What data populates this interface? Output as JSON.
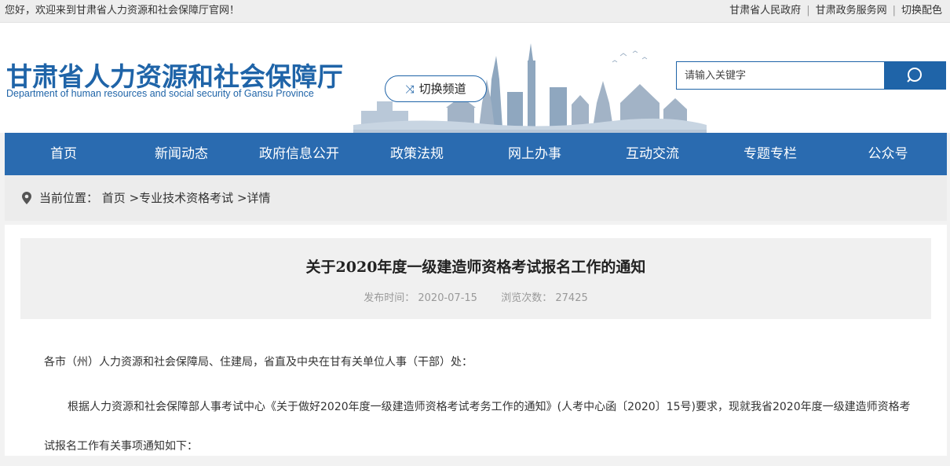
{
  "topbar": {
    "welcome": "您好，欢迎来到甘肃省人力资源和社会保障厅官网！",
    "links": [
      "甘肃省人民政府",
      "甘肃政务服务网",
      "切换配色"
    ]
  },
  "header": {
    "title_cn": "甘肃省人力资源和社会保障厅",
    "title_en": "Department of human resources and social security of Gansu Province",
    "switch_label": "切换频道",
    "search_placeholder": "请输入关键字"
  },
  "nav": [
    "首页",
    "新闻动态",
    "政府信息公开",
    "政策法规",
    "网上办事",
    "互动交流",
    "专题专栏",
    "公众号"
  ],
  "breadcrumb": {
    "label": "当前位置：",
    "items": [
      "首页",
      "专业技术资格考试",
      "详情"
    ]
  },
  "article": {
    "title": "关于2020年度一级建造师资格考试报名工作的通知",
    "publish_label": "发布时间：",
    "publish_date": "2020-07-15",
    "views_label": "浏览次数：",
    "views": "27425",
    "para1": "各市（州）人力资源和社会保障局、住建局，省直及中央在甘有关单位人事（干部）处：",
    "para2": "根据人力资源和社会保障部人事考试中心《关于做好2020年度一级建造师资格考试考务工作的通知》(人考中心函〔2020〕15号)要求，现就我省2020年度一级建造师资格考试报名工作有关事项通知如下："
  },
  "colors": {
    "brand": "#1f64a8",
    "nav": "#2a6bb0"
  },
  "icons": [
    "shuffle-icon",
    "search-icon",
    "location-pin-icon"
  ]
}
